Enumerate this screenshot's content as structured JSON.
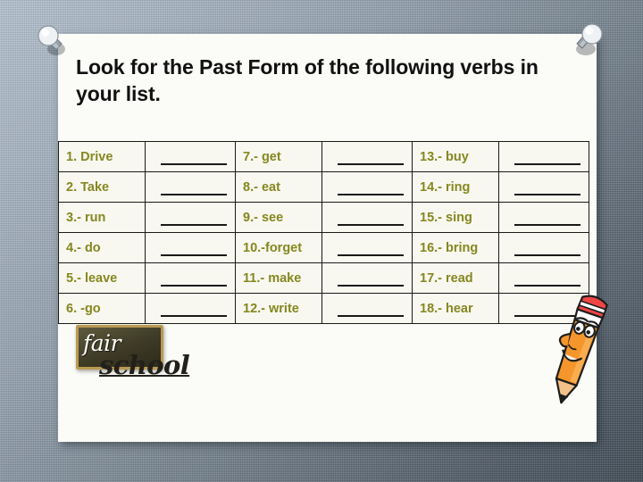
{
  "slide": {
    "background_top_color": "#b4c2d0",
    "background_bottom_color": "#3b4752",
    "card_color": "#fbfbf7"
  },
  "title": {
    "text": "Look for the Past Form of the following verbs in your list."
  },
  "table": {
    "text_color": "#86871f",
    "border_color": "#1a1a16",
    "cell_background": "#f8f8f1",
    "rows": [
      {
        "c1": "1. Drive",
        "b1": "",
        "c2": "7.- get",
        "b2": "",
        "c3": "13.- buy",
        "b3": ""
      },
      {
        "c1": "2. Take",
        "b1": "",
        "c2": "8.- eat",
        "b2": "",
        "c3": "14.- ring",
        "b3": ""
      },
      {
        "c1": "3.- run",
        "b1": "",
        "c2": "9.- see",
        "b2": "",
        "c3": "15.- sing",
        "b3": ""
      },
      {
        "c1": "4.- do",
        "b1": "",
        "c2": "10.-forget",
        "b2": "",
        "c3": "16.- bring",
        "b3": ""
      },
      {
        "c1": "5.- leave",
        "b1": "",
        "c2": "11.- make",
        "b2": "",
        "c3": "17.- read",
        "b3": ""
      },
      {
        "c1": "6. -go",
        "b1": "",
        "c2": "12.- write",
        "b2": "",
        "c3": "18.- hear",
        "b3": ""
      }
    ]
  },
  "logo": {
    "word_one": "fair",
    "word_two": "school"
  },
  "decorations": {
    "pin_left": "pushpin-icon",
    "pin_right": "pushpin-icon",
    "pencil": "pencil-mascot-icon"
  }
}
